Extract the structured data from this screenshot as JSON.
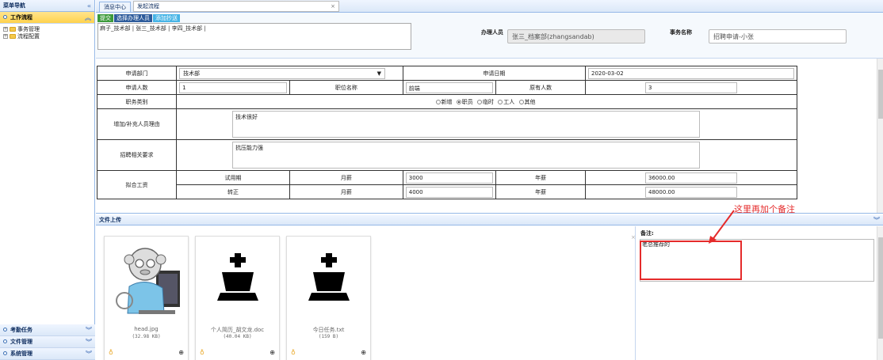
{
  "sidebar": {
    "title": "菜单导航",
    "collapse_icon": "«",
    "active_section": "工作流程",
    "tree": [
      {
        "label": "事务管理"
      },
      {
        "label": "流程配置"
      }
    ],
    "bottom_sections": [
      {
        "label": "考勤任务"
      },
      {
        "label": "文件管理"
      },
      {
        "label": "系统管理"
      }
    ]
  },
  "tabs": [
    {
      "label": "消息中心"
    },
    {
      "label": "发起流程",
      "closable": "×"
    }
  ],
  "toolbar": {
    "submit": "提交",
    "choose": "选择办理人员",
    "cc": "添加抄送"
  },
  "handlers_text": "麻子_技术部 | 张三_技术部 | 李四_技术部 |",
  "handler": {
    "label": "办理人员",
    "value": "张三_档案部(zhangsandab)"
  },
  "affair": {
    "label": "事务名称",
    "value": "招聘申请-小张"
  },
  "form": {
    "dept_label": "申请部门",
    "dept_value": "技术部",
    "date_label": "申请日期",
    "date_value": "2020-03-02",
    "count_label": "申请人数",
    "count_value": "1",
    "position_label": "职位名称",
    "position_value": "前端",
    "existing_label": "原有人数",
    "existing_value": "3",
    "type_label": "职务类别",
    "type_options": [
      {
        "label": "新增",
        "checked": false
      },
      {
        "label": "职员",
        "checked": true
      },
      {
        "label": "临时",
        "checked": false
      },
      {
        "label": "工人",
        "checked": false
      },
      {
        "label": "其他",
        "checked": false
      }
    ],
    "reason_label": "增加/补充人员理由",
    "reason_value": "技术很好",
    "req_label": "招聘相关要求",
    "req_value": "抗压能力强",
    "salary_label": "拟合工资",
    "probation_label": "试用期",
    "regular_label": "转正",
    "monthly_label": "月薪",
    "yearly_label": "年薪",
    "probation_monthly": "3000",
    "probation_yearly": "36000.00",
    "regular_monthly": "4000",
    "regular_yearly": "48000.00"
  },
  "upload": {
    "title": "文件上传",
    "files": [
      {
        "name": "head.jpg",
        "size": "(32.98 KB)"
      },
      {
        "name": "个人简历_胡文龙.doc",
        "size": "(40.04 KB)"
      },
      {
        "name": "今日任务.txt",
        "size": "(159 B)"
      }
    ],
    "note_label": "备注:",
    "note_value": "老总推荐的"
  },
  "annotation": {
    "text": "这里再加个备注",
    "color": "#e52b2b"
  },
  "colors": {
    "accent": "#95b8e7",
    "active": "#ffd24d",
    "submit": "#3c9a3a",
    "choose": "#2d5b9b",
    "cc": "#46b4e6"
  }
}
